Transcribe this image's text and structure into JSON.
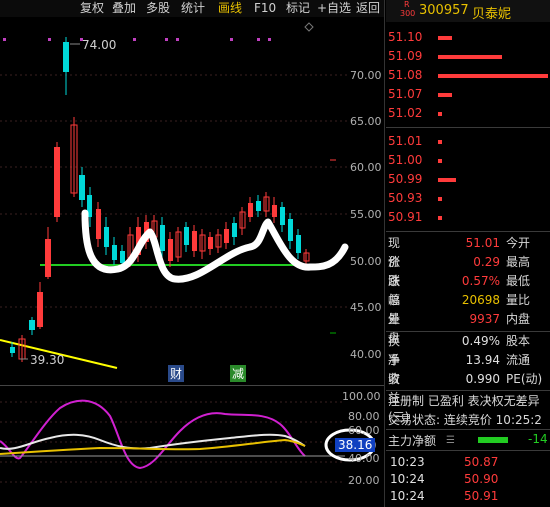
{
  "toolbar": {
    "items": [
      "复权",
      "叠加",
      "多股",
      "统计",
      "画线",
      "F10",
      "标记",
      "+自选",
      "返回"
    ],
    "active_index": 4
  },
  "chart": {
    "price_axis": [
      "70.00",
      "65.00",
      "60.00",
      "55.00",
      "50.00",
      "45.00",
      "40.00"
    ],
    "high_label": "74.00",
    "low_label": "39.30",
    "markers": [
      "财",
      "减"
    ]
  },
  "indicator": {
    "axis": [
      "100.00",
      "80.00",
      "60.00",
      "40.00",
      "20.00"
    ],
    "current_value": "38.16"
  },
  "stock": {
    "badge_top": "R",
    "badge_bottom": "300",
    "code": "300957",
    "name": "贝泰妮"
  },
  "order_book": {
    "asks": [
      {
        "price": "51.10",
        "volume_level": 0.12
      },
      {
        "price": "51.09",
        "volume_level": 0.5
      },
      {
        "price": "51.08",
        "volume_level": 1.0
      },
      {
        "price": "51.07",
        "volume_level": 0.12
      },
      {
        "price": "51.02",
        "volume_level": 0.04
      }
    ],
    "bids": [
      {
        "price": "51.01",
        "volume_level": 0.04
      },
      {
        "price": "51.00",
        "volume_level": 0.04
      },
      {
        "price": "50.99",
        "volume_level": 0.15
      },
      {
        "price": "50.93",
        "volume_level": 0.04
      },
      {
        "price": "50.91",
        "volume_level": 0.04
      }
    ]
  },
  "stats": [
    {
      "label": "现价",
      "value": "51.01",
      "tail": "今开",
      "color": "red"
    },
    {
      "label": "涨跌",
      "value": "0.29",
      "tail": "最高",
      "color": "red"
    },
    {
      "label": "涨幅",
      "value": "0.57%",
      "tail": "最低",
      "color": "red"
    },
    {
      "label": "总量",
      "value": "20698",
      "tail": "量比",
      "color": "yellow"
    },
    {
      "label": "外盘",
      "value": "9937",
      "tail": "内盘",
      "color": "red"
    }
  ],
  "stats2": [
    {
      "label": "换手",
      "value": "0.49%",
      "tail": "股本",
      "color": "white"
    },
    {
      "label": "净资",
      "value": "13.94",
      "tail": "流通",
      "color": "white"
    },
    {
      "label": "收益(三)",
      "value": "0.990",
      "tail": "PE(动)",
      "color": "white"
    }
  ],
  "info": {
    "registration": "注册制 已盈利 表决权无差异",
    "status": "交易状态: 连续竞价 10:25:2",
    "main_force_label": "主力净额",
    "main_force_value": "-14"
  },
  "ticks": [
    {
      "time": "10:23",
      "price": "50.87"
    },
    {
      "time": "10:24",
      "price": "50.90"
    },
    {
      "time": "10:24",
      "price": "50.91"
    }
  ],
  "colors": {
    "up": "#ff3b3b",
    "down": "#00d9d9",
    "support_line": "#22cc22",
    "trend_line": "#ffff00",
    "accent": "#e8c000"
  }
}
